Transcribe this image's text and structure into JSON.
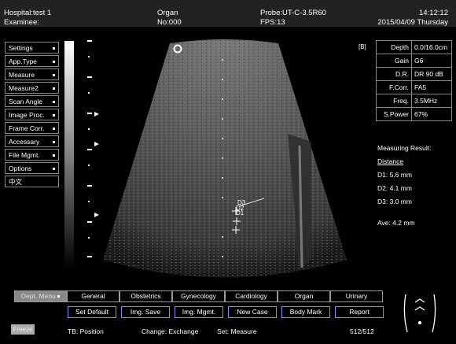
{
  "header": {
    "hospital": "Hospital:test 1",
    "examinee": "Examinee:",
    "organ": "Organ",
    "no": "No:000",
    "probe": "Probe:UT-C-3.5R60",
    "fps": "FPS:13",
    "time": "14:12:12",
    "date": "2015/04/09 Thursday"
  },
  "side_menu": [
    {
      "label": "Settings"
    },
    {
      "label": "App.Type"
    },
    {
      "label": "Measure"
    },
    {
      "label": "Measure2"
    },
    {
      "label": "Scan Angle"
    },
    {
      "label": "Image Proc."
    },
    {
      "label": "Frame Corr."
    },
    {
      "label": "Accessary"
    },
    {
      "label": "File Mgmt."
    },
    {
      "label": "Options"
    },
    {
      "label": "中文"
    }
  ],
  "marker_b": "[B]",
  "params": [
    {
      "key": "Depth",
      "value": "0.0/16.0cm"
    },
    {
      "key": "Gain",
      "value": "G6"
    },
    {
      "key": "D.R.",
      "value": "DR 90 dB"
    },
    {
      "key": "F.Corr.",
      "value": "FA5"
    },
    {
      "key": "Freq.",
      "value": "3.5MHz"
    },
    {
      "key": "S.Power",
      "value": "67%"
    }
  ],
  "measurement": {
    "title": "Measuring Result:",
    "subtitle": "Distance",
    "d1": "D1: 5.6 mm",
    "d2": "D2: 4.1 mm",
    "d3": "D3: 3.0 mm",
    "ave": "Ave: 4.2 mm",
    "labels": [
      "D3",
      "D2",
      "D1"
    ]
  },
  "tabs": [
    "Dept. Menu",
    "General",
    "Obstetrics",
    "Gynecology",
    "Cardiology",
    "Organ",
    "Urinary"
  ],
  "buttons": [
    "Set Default",
    "Img. Save",
    "Img. Mgmt.",
    "New Case",
    "Body Mark",
    "Report"
  ],
  "status": {
    "freeze": "Freeze",
    "tb": "TB: Position",
    "change": "Change: Exchange",
    "set": "Set: Measure",
    "frames": "512/512"
  }
}
